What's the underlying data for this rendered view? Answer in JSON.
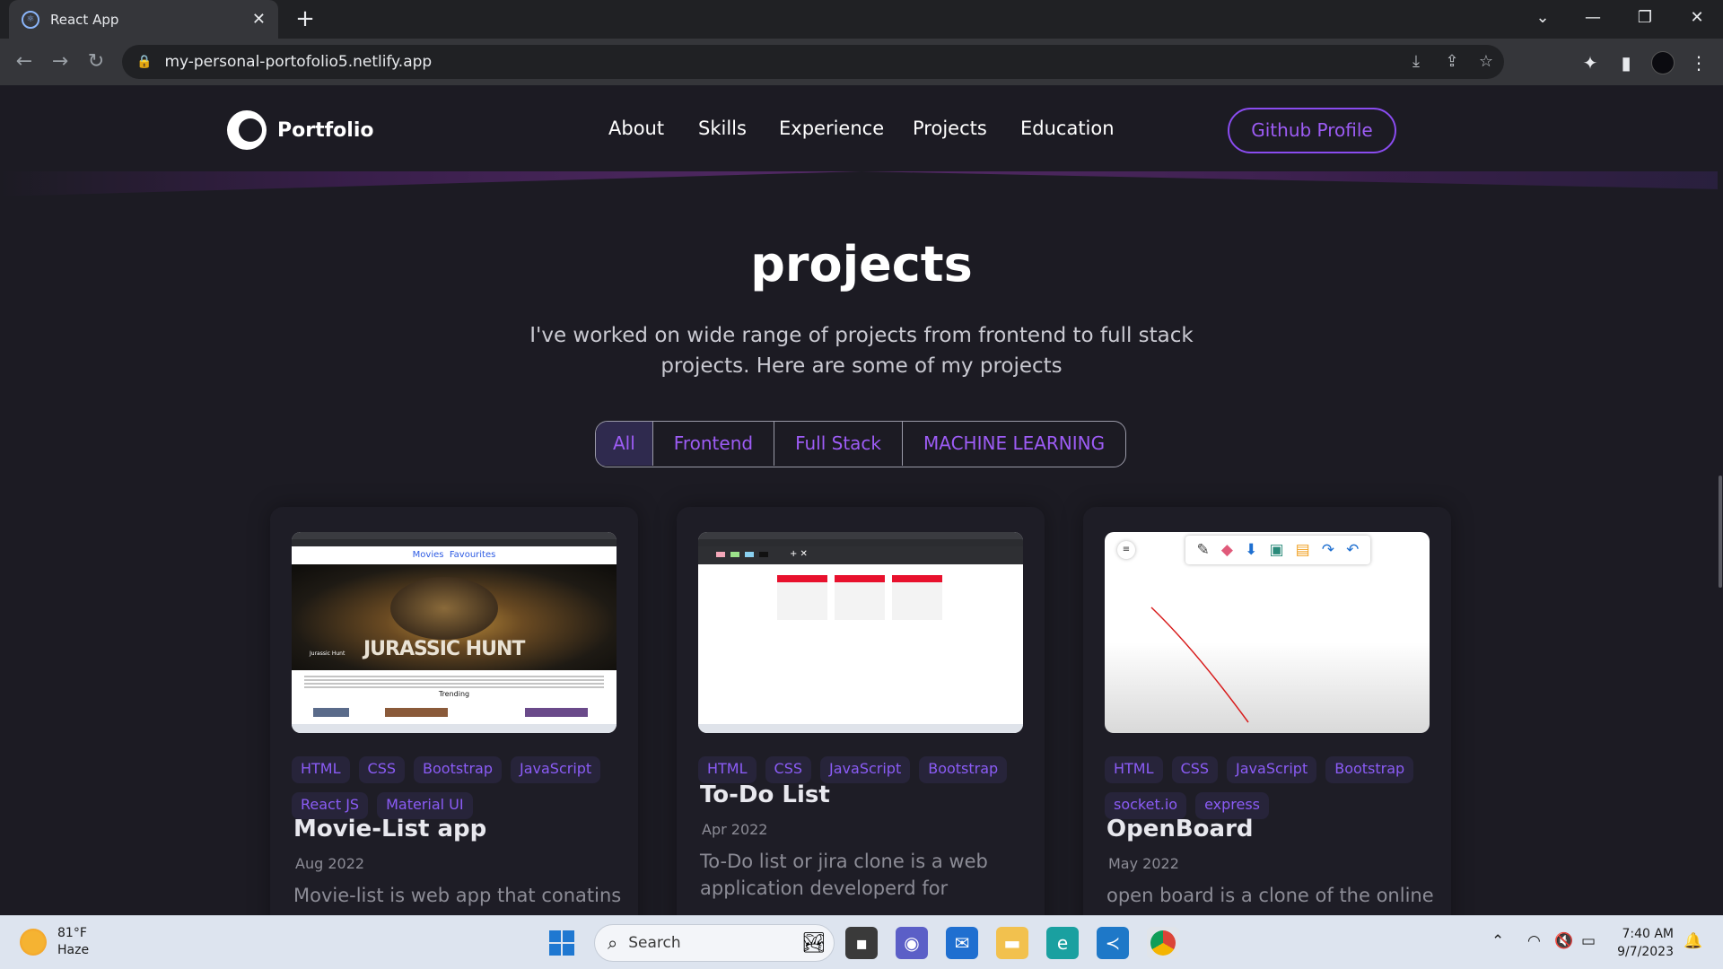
{
  "browser": {
    "tab_title": "React App",
    "url": "my-personal-portofolio5.netlify.app"
  },
  "site": {
    "logo_text": "Portfolio",
    "nav": [
      "About",
      "Skills",
      "Experience",
      "Projects",
      "Education"
    ],
    "github_button": "Github Profile"
  },
  "section": {
    "title": "projects",
    "subtitle": "I've worked on wide range of projects from frontend to full stack projects. Here are some of my projects",
    "filters": [
      "All",
      "Frontend",
      "Full Stack",
      "MACHINE LEARNING"
    ],
    "active_filter": "All"
  },
  "projects": [
    {
      "tags": [
        "HTML",
        "CSS",
        "Bootstrap",
        "JavaScript",
        "React JS",
        "Material UI"
      ],
      "title": "Movie-List app",
      "date": "Aug 2022",
      "description": "Movie-list is web app that conatins",
      "thumb": {
        "nav1": "Movies",
        "nav2": "Favourites",
        "hero": "JURASSIC HUNT",
        "small": "Jurassic Hunt",
        "row": "Trending"
      }
    },
    {
      "tags": [
        "HTML",
        "CSS",
        "JavaScript",
        "Bootstrap"
      ],
      "title": "To-Do List",
      "date": "Apr 2022",
      "description": "To-Do list or jira clone is a web application developerd for"
    },
    {
      "tags": [
        "HTML",
        "CSS",
        "JavaScript",
        "Bootstrap",
        "socket.io",
        "express"
      ],
      "title": "OpenBoard",
      "date": "May 2022",
      "description": "open board is a clone of the online"
    }
  ],
  "taskbar": {
    "temperature": "81°F",
    "condition": "Haze",
    "search_label": "Search",
    "time": "7:40 AM",
    "date": "9/7/2023"
  },
  "colors": {
    "accent": "#8b5cf6",
    "background": "#1c1b23",
    "card": "#1e1d26"
  }
}
